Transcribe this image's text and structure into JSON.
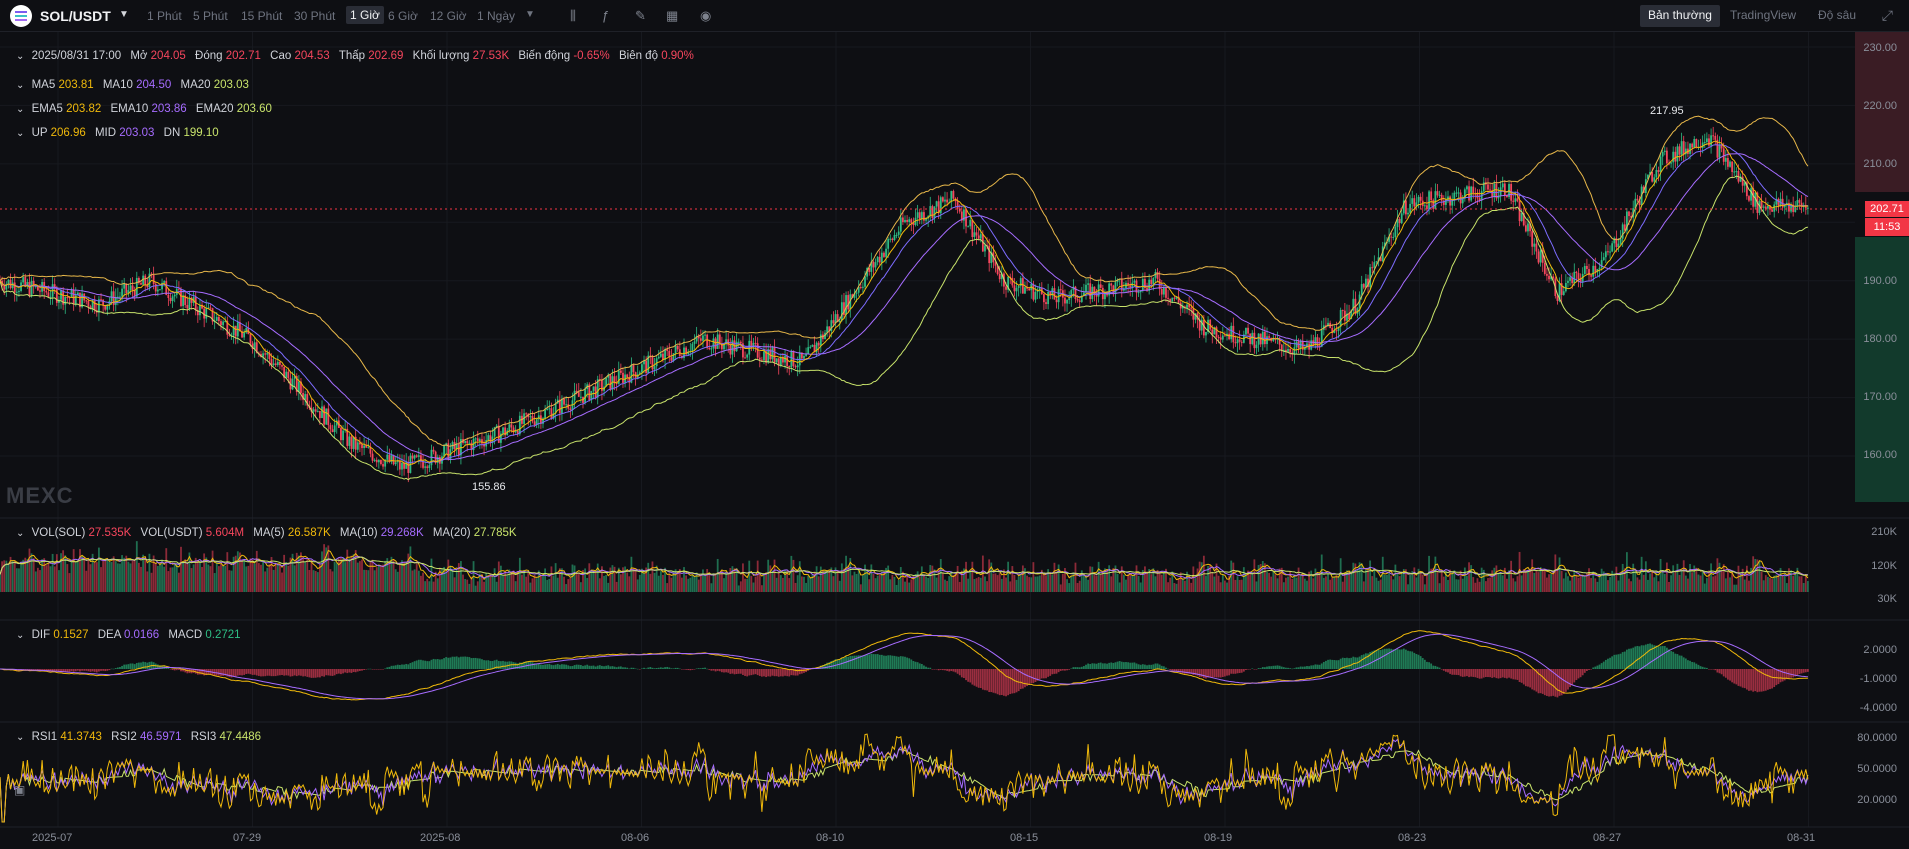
{
  "toolbar": {
    "pair": "SOL/USDT",
    "timeframes": [
      "1 Phút",
      "5 Phút",
      "15 Phút",
      "30 Phút",
      "1 Giờ",
      "6 Giờ",
      "12 Giờ",
      "1 Ngày"
    ],
    "active_timeframe": "1 Giờ",
    "view_modes": [
      "Bản thường",
      "TradingView",
      "Độ sâu"
    ],
    "active_view": "Bản thường",
    "tools": [
      "candle-type-icon",
      "indicator-icon",
      "draw-icon",
      "layout-icon",
      "camera-icon"
    ]
  },
  "ohlc_legend": {
    "date": "2025/08/31 17:00",
    "open_label": "Mở",
    "open": "204.05",
    "close_label": "Đóng",
    "close": "202.71",
    "high_label": "Cao",
    "high": "204.53",
    "low_label": "Thấp",
    "low": "202.69",
    "volume_label": "Khối lượng",
    "volume": "27.53K",
    "change_label": "Biến động",
    "change": "-0.65%",
    "amplitude_label": "Biên độ",
    "amplitude": "0.90%"
  },
  "ma_legend": {
    "ma5": "203.81",
    "ma10": "204.50",
    "ma20": "203.03"
  },
  "ema_legend": {
    "ema5": "203.82",
    "ema10": "203.86",
    "ema20": "203.60"
  },
  "boll_legend": {
    "up": "206.96",
    "mid": "203.03",
    "dn": "199.10"
  },
  "vol_legend": {
    "vol_sol": "27.535K",
    "vol_usdt": "5.604M",
    "ma5": "26.587K",
    "ma10": "29.268K",
    "ma20": "27.785K"
  },
  "macd_legend": {
    "dif": "0.1527",
    "dea": "0.0166",
    "macd": "0.2721"
  },
  "rsi_legend": {
    "rsi1": "41.3743",
    "rsi2": "46.5971",
    "rsi3": "47.4486"
  },
  "price_axis": [
    "230.00",
    "220.00",
    "210.00",
    "190.00",
    "180.00",
    "170.00",
    "160.00"
  ],
  "current_price": {
    "value": "202.71",
    "countdown": "11:53"
  },
  "peak": {
    "high": "217.95",
    "low": "155.86"
  },
  "volume_axis": [
    "210K",
    "120K",
    "30K"
  ],
  "macd_axis": [
    "2.0000",
    "-1.0000",
    "-4.0000"
  ],
  "rsi_axis": [
    "80.0000",
    "50.0000",
    "20.0000"
  ],
  "date_axis": [
    "2025-07",
    "07-29",
    "2025-08",
    "08-06",
    "08-10",
    "08-15",
    "08-19",
    "08-23",
    "08-27",
    "08-31"
  ],
  "watermark": "MEXC",
  "colors": {
    "up": "#2ebd85",
    "down": "#f6465d",
    "ma5": "#f0b90b",
    "ma10": "#a66cff",
    "ma20": "#c8e36b",
    "boll": "#e8b84a"
  },
  "chart_data": {
    "type": "candlestick",
    "symbol": "SOL/USDT",
    "interval": "1h",
    "x_range": [
      "2025-07-26",
      "2025-08-31"
    ],
    "ylim": [
      150,
      232
    ],
    "close_trend": [
      [
        "2025-07-26",
        190
      ],
      [
        "2025-07-28",
        186
      ],
      [
        "2025-07-29",
        190
      ],
      [
        "2025-07-31",
        180
      ],
      [
        "2025-08-02",
        162
      ],
      [
        "2025-08-03",
        158
      ],
      [
        "2025-08-05",
        164
      ],
      [
        "2025-08-07",
        172
      ],
      [
        "2025-08-09",
        180
      ],
      [
        "2025-08-11",
        176
      ],
      [
        "2025-08-13",
        200
      ],
      [
        "2025-08-14",
        204
      ],
      [
        "2025-08-15",
        190
      ],
      [
        "2025-08-16",
        187
      ],
      [
        "2025-08-18",
        190
      ],
      [
        "2025-08-19",
        182
      ],
      [
        "2025-08-21",
        178
      ],
      [
        "2025-08-22",
        186
      ],
      [
        "2025-08-23",
        203
      ],
      [
        "2025-08-25",
        206
      ],
      [
        "2025-08-26",
        188
      ],
      [
        "2025-08-27",
        194
      ],
      [
        "2025-08-28",
        210
      ],
      [
        "2025-08-29",
        215
      ],
      [
        "2025-08-30",
        203
      ],
      [
        "2025-08-31",
        202.71
      ]
    ]
  }
}
